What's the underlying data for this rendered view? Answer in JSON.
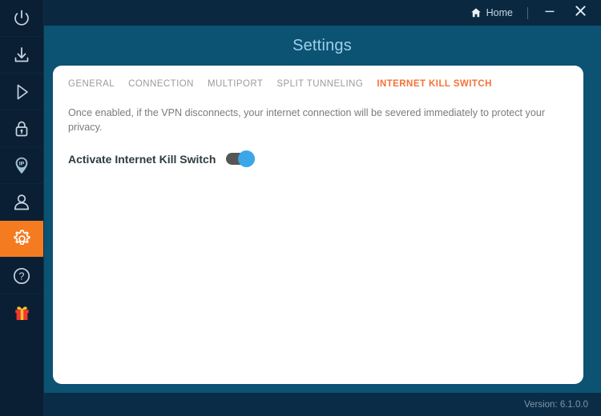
{
  "window": {
    "home_label": "Home",
    "minimize_label": "—",
    "close_label": "✕"
  },
  "sidebar": {
    "items": [
      {
        "name": "power",
        "icon": "power-icon",
        "active": false
      },
      {
        "name": "download",
        "icon": "download-icon",
        "active": false
      },
      {
        "name": "play",
        "icon": "play-icon",
        "active": false
      },
      {
        "name": "lock",
        "icon": "lock-icon",
        "active": false
      },
      {
        "name": "ip",
        "icon": "ip-pin-icon",
        "active": false
      },
      {
        "name": "account",
        "icon": "person-icon",
        "active": false
      },
      {
        "name": "settings",
        "icon": "gear-icon",
        "active": true
      },
      {
        "name": "help",
        "icon": "question-mark-icon",
        "active": false
      },
      {
        "name": "gift",
        "icon": "gift-icon",
        "active": false
      }
    ]
  },
  "page": {
    "title": "Settings"
  },
  "tabs": [
    {
      "label": "GENERAL",
      "active": false
    },
    {
      "label": "CONNECTION",
      "active": false
    },
    {
      "label": "MULTIPORT",
      "active": false
    },
    {
      "label": "SPLIT TUNNELING",
      "active": false
    },
    {
      "label": "INTERNET KILL SWITCH",
      "active": true
    }
  ],
  "content": {
    "description": "Once enabled, if the VPN disconnects, your internet connection will be severed immediately to protect your privacy.",
    "toggle_label": "Activate Internet Kill Switch",
    "toggle_state": "on"
  },
  "footer": {
    "version": "Version:  6.1.0.0"
  },
  "colors": {
    "accent_orange": "#f47b20",
    "toggle_blue": "#3ba7e8",
    "title_bar": "#0a2840",
    "body_teal": "#0b5273",
    "sidebar": "#0a1f33",
    "footer": "#0b2c47"
  }
}
